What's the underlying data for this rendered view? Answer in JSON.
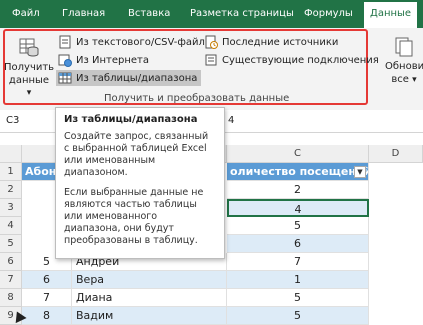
{
  "ribbon": {
    "tabs": [
      "Файл",
      "Главная",
      "Вставка",
      "Разметка страницы",
      "Формулы",
      "Данные"
    ],
    "get_data_label": "Получить данные",
    "get_data_arrow": "▾",
    "commands": {
      "from_text_csv": "Из текстового/CSV-файла",
      "from_web": "Из Интернета",
      "from_table": "Из таблицы/диапазона",
      "recent_sources": "Последние источники",
      "existing_connections": "Существующие подключения"
    },
    "group_label": "Получить и преобразовать данные",
    "refresh_label": "Обнови все",
    "refresh_arrow": "▾"
  },
  "formula_bar": {
    "name_box": "C3",
    "value": "4"
  },
  "grid": {
    "columns": [
      "C",
      "D"
    ],
    "rows": [
      "1",
      "2",
      "3",
      "4",
      "5",
      "6",
      "7",
      "8",
      "9"
    ],
    "header": {
      "name": "Абон",
      "visits": "оличество посещений"
    },
    "data": [
      {
        "id": "",
        "name": "",
        "visits": "2"
      },
      {
        "id": "",
        "name": "",
        "visits": "4"
      },
      {
        "id": "",
        "name": "",
        "visits": "5"
      },
      {
        "id": "",
        "name": "",
        "visits": "6"
      },
      {
        "id": "5",
        "name": "Андрей",
        "visits": "7"
      },
      {
        "id": "6",
        "name": "Вера",
        "visits": "1"
      },
      {
        "id": "7",
        "name": "Диана",
        "visits": "5"
      },
      {
        "id": "8",
        "name": "Вадим",
        "visits": "5"
      }
    ]
  },
  "tooltip": {
    "title": "Из таблицы/диапазона",
    "p1": "Создайте запрос, связанный с выбранной таблицей Excel или именованным диапазоном.",
    "p2": "Если выбранные данные не являются частью таблицы или именованного диапазона, они будут преобразованы в таблицу."
  },
  "colors": {
    "excel_green": "#217346",
    "table_header_blue": "#5b9bd5",
    "highlight_red": "#e53935"
  }
}
